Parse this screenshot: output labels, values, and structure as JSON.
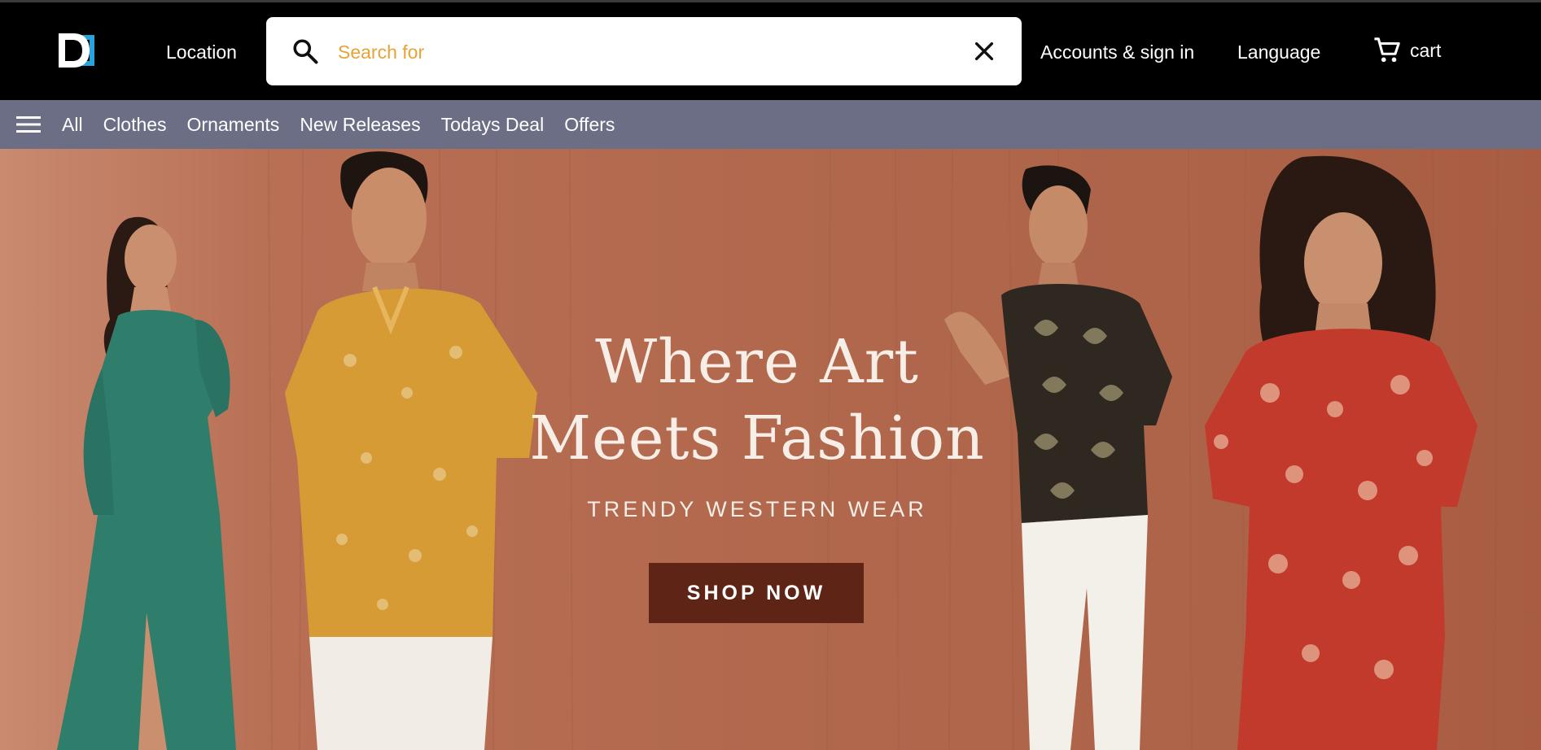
{
  "header": {
    "logo_alt": "D logo",
    "location_label": "Location",
    "search": {
      "placeholder": "Search for",
      "value": ""
    },
    "accounts_label": "Accounts & sign in",
    "language_label": "Language",
    "cart_label": "cart"
  },
  "subnav": {
    "items": [
      {
        "label": "All"
      },
      {
        "label": "Clothes"
      },
      {
        "label": "Ornaments"
      },
      {
        "label": "New Releases"
      },
      {
        "label": "Todays Deal"
      },
      {
        "label": "Offers"
      }
    ]
  },
  "hero": {
    "title_line1": "Where Art",
    "title_line2": "Meets Fashion",
    "subtitle": "TRENDY WESTERN WEAR",
    "cta_label": "SHOP NOW"
  },
  "colors": {
    "topbar": "#000000",
    "subnav": "#6b6e84",
    "search_placeholder": "#e8a236",
    "hero_bg": "#b1684d",
    "cta_bg": "#5e2416",
    "logo_blue": "#29a3dd"
  },
  "icons": [
    "logo-icon",
    "search-icon",
    "close-icon",
    "cart-icon",
    "menu-icon"
  ]
}
